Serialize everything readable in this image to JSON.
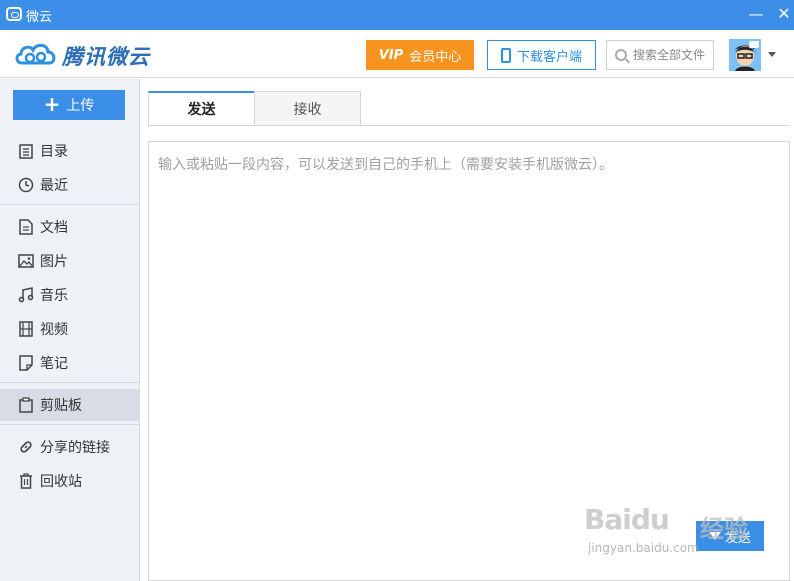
{
  "window": {
    "title": "微云",
    "minimize_glyph": "—",
    "close_glyph": "✕"
  },
  "header": {
    "logo_text": "腾讯微云",
    "vip_mark": "VIP",
    "vip_label": "会员中心",
    "download_label": "下载客户端",
    "search_placeholder": "搜索全部文件"
  },
  "sidebar": {
    "upload_label": "上传",
    "items": [
      {
        "label": "目录",
        "icon": "list-icon"
      },
      {
        "label": "最近",
        "icon": "clock-icon"
      },
      {
        "label": "文档",
        "icon": "document-icon"
      },
      {
        "label": "图片",
        "icon": "image-icon"
      },
      {
        "label": "音乐",
        "icon": "music-icon"
      },
      {
        "label": "视频",
        "icon": "film-icon"
      },
      {
        "label": "笔记",
        "icon": "note-icon"
      },
      {
        "label": "剪贴板",
        "icon": "clipboard-icon",
        "active": true
      },
      {
        "label": "分享的链接",
        "icon": "link-icon"
      },
      {
        "label": "回收站",
        "icon": "trash-icon"
      }
    ]
  },
  "main": {
    "tabs": [
      {
        "label": "发送",
        "active": true
      },
      {
        "label": "接收",
        "active": false
      }
    ],
    "editor_placeholder": "输入或粘贴一段内容，可以发送到自己的手机上（需要安装手机版微云）。",
    "send_label": "发送"
  },
  "watermark": {
    "brand": "Baidu",
    "suffix": "经验",
    "site": "jingyan.baidu.com"
  },
  "colors": {
    "titlebar": "#3d8ee8",
    "accent": "#3a8ee6",
    "vip": "#f7931e",
    "sidebar_bg": "#eef1f6",
    "sidebar_active": "#d7dce6"
  }
}
